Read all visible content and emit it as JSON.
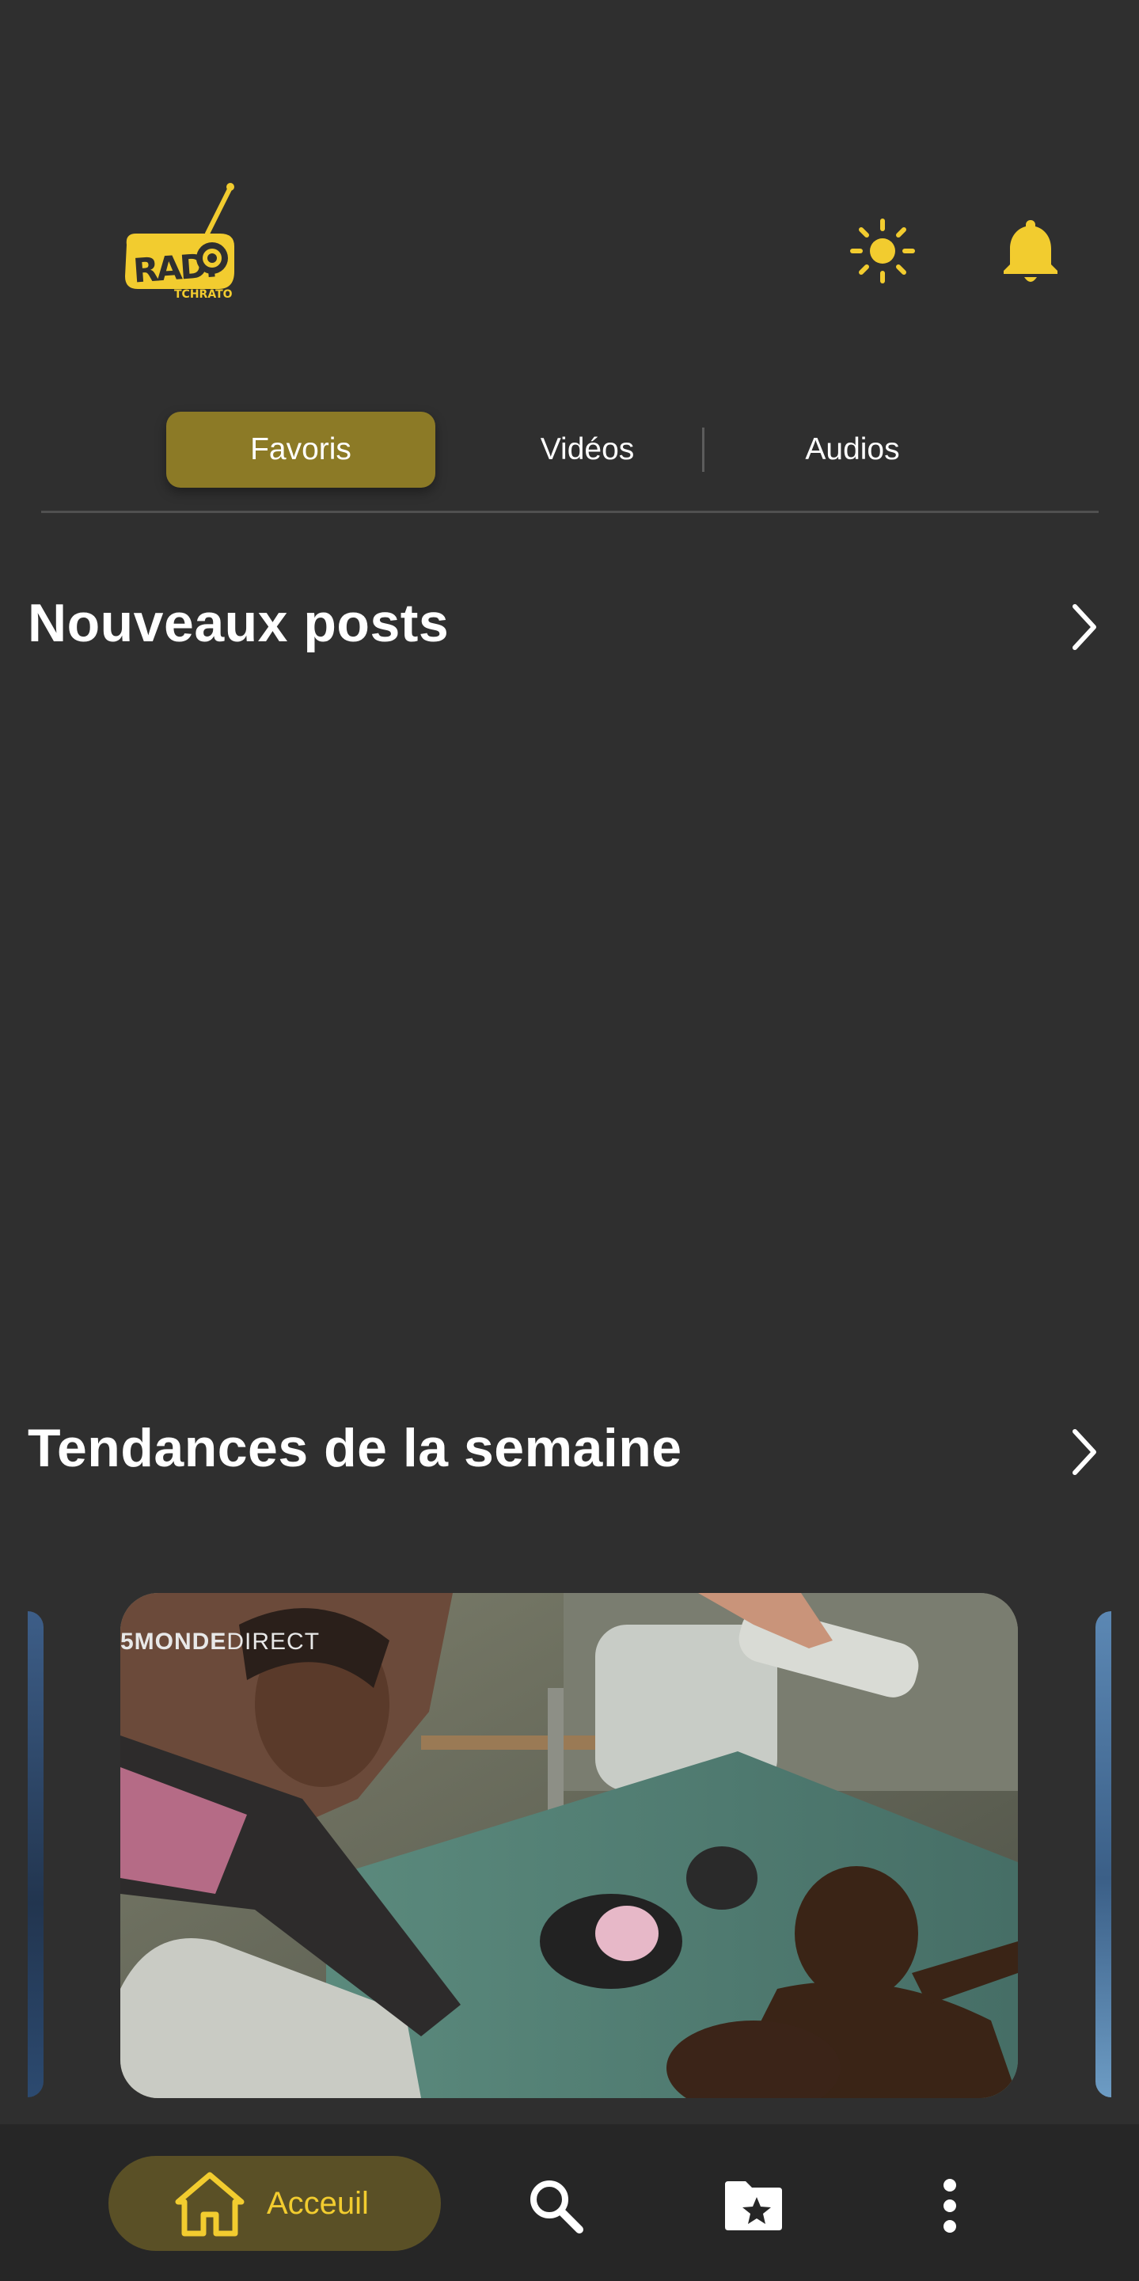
{
  "header": {
    "logo": {
      "text_main": "RADIO",
      "text_sub": "TCHRATO"
    },
    "icons": [
      "sun-icon",
      "bell-icon"
    ]
  },
  "tabs": [
    {
      "label": "Favoris",
      "active": true
    },
    {
      "label": "Vidéos",
      "active": false
    },
    {
      "label": "Audios",
      "active": false
    }
  ],
  "sections": {
    "new_posts": {
      "title": "Nouveaux posts"
    },
    "trending": {
      "title": "Tendances de la semaine"
    }
  },
  "carousel": {
    "watermark_bold": "5MONDE",
    "watermark_rest": "DIRECT"
  },
  "bottom_nav": {
    "home_label": "Acceuil",
    "items": [
      "home-icon",
      "search-icon",
      "favorites-folder-icon",
      "more-vert-icon"
    ]
  },
  "colors": {
    "background": "#2f2f2f",
    "accent": "#f2cc2f",
    "active_tab": "#8c7a26",
    "nav_bg": "#262626",
    "nav_active_pill": "#5a5026"
  }
}
